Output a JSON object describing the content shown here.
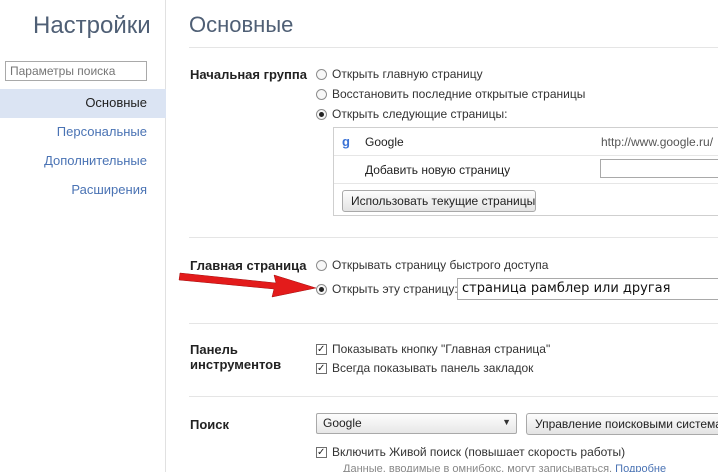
{
  "sidebar": {
    "title": "Настройки",
    "search_placeholder": "Параметры поиска",
    "items": [
      {
        "label": "Основные",
        "active": true
      },
      {
        "label": "Персональные",
        "active": false
      },
      {
        "label": "Дополнительные",
        "active": false
      },
      {
        "label": "Расширения",
        "active": false
      }
    ]
  },
  "main": {
    "title": "Основные",
    "startup": {
      "label": "Начальная группа",
      "options": [
        {
          "label": "Открыть главную страницу",
          "selected": false
        },
        {
          "label": "Восстановить последние открытые страницы",
          "selected": false
        },
        {
          "label": "Открыть следующие страницы:",
          "selected": true
        }
      ],
      "pages": [
        {
          "name": "Google",
          "url": "http://www.google.ru/",
          "icon": "google-favicon-icon"
        }
      ],
      "add_page_label": "Добавить новую страницу",
      "use_current_button": "Использовать текущие страницы"
    },
    "home": {
      "label": "Главная страница",
      "options": [
        {
          "label": "Открывать страницу быстрого доступа",
          "selected": false
        },
        {
          "label": "Открыть эту страницу:",
          "selected": true
        }
      ],
      "url_value": "страница рамблер или другая"
    },
    "toolbar": {
      "label_line1": "Панель",
      "label_line2": "инструментов",
      "checks": [
        {
          "label": "Показывать кнопку \"Главная страница\"",
          "checked": true
        },
        {
          "label": "Всегда показывать панель закладок",
          "checked": true
        }
      ]
    },
    "search": {
      "label": "Поиск",
      "engine": "Google",
      "manage_button": "Управление поисковыми система",
      "instant_label": "Включить Живой поиск (повышает скорость работы)",
      "instant_checked": true,
      "hint_text": "Данные, вводимые в омнибокс, могут записываться.",
      "hint_link": "Подробне"
    }
  },
  "annotation": {
    "arrow_color": "#e31b1b"
  }
}
